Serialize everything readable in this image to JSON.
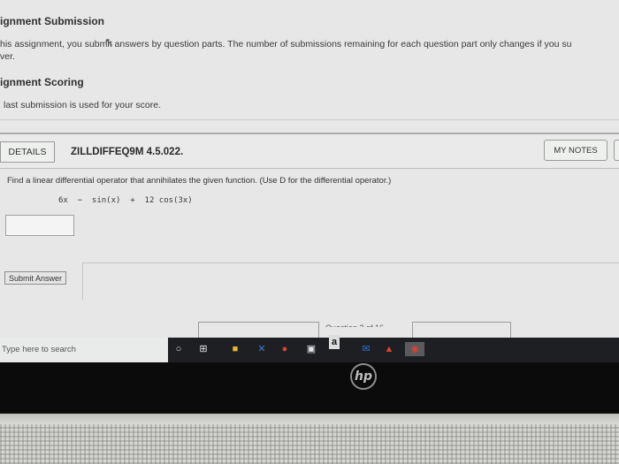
{
  "assignment_submission": {
    "title": "ignment Submission",
    "text_line1": "his assignment, you submit answers by question parts. The number of submissions remaining for each question part only changes if you su",
    "text_line2": "ver."
  },
  "assignment_scoring": {
    "title": "ignment Scoring",
    "text": "last submission is used for your score."
  },
  "question": {
    "details_label": "DETAILS",
    "id": "ZILLDIFFEQ9M 4.5.022.",
    "notes_label": "MY NOTES",
    "prompt": "Find a linear differential operator that annihilates the given function. (Use D for the differential operator.)",
    "function": "6x  −  sin(x)  +  12 cos(3x)",
    "answer_value": "",
    "submit_label": "Submit Answer",
    "pager": "Question 2 of 16"
  },
  "taskbar": {
    "search_placeholder": "Type here to search",
    "store_glyph": "a"
  },
  "laptop": {
    "brand": "hp"
  },
  "colors": {
    "chrome_icon": "#e0402e",
    "file_explorer": "#e7b43a",
    "edge_blue": "#3a7bd5"
  }
}
